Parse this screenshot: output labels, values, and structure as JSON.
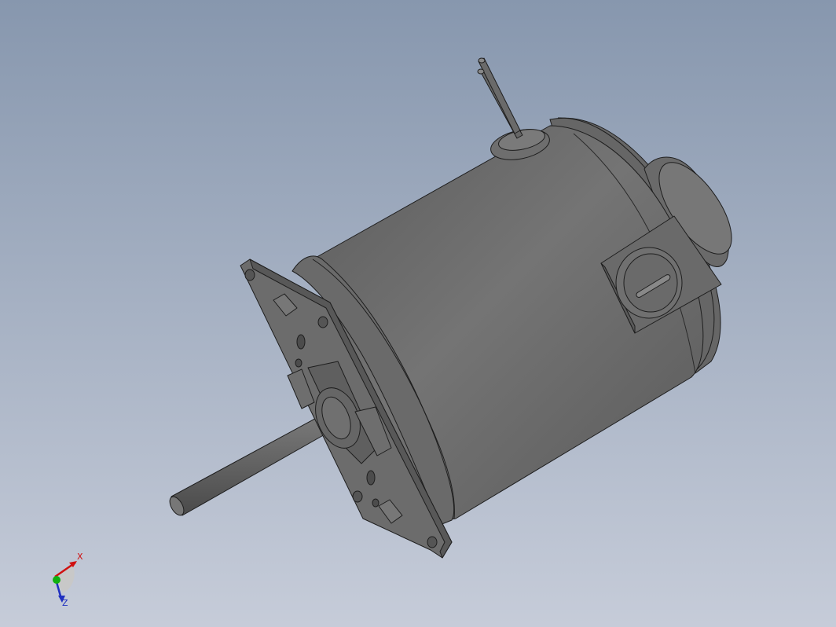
{
  "viewport": {
    "background_top": "#8797ae",
    "background_bottom": "#c6ccd9",
    "model_color": "#6e6e6e",
    "edge_color": "#1e1e1e"
  },
  "triad": {
    "x_label": "X",
    "z_label": "Z",
    "x_color": "#d01010",
    "y_color": "#10b010",
    "z_color": "#2030c0"
  }
}
